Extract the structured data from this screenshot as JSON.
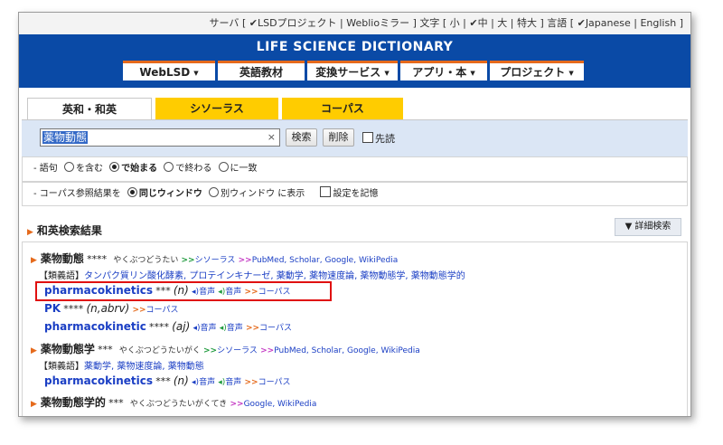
{
  "topbar": {
    "server_label": "サーバ",
    "server_opt1": "LSDプロジェクト",
    "server_opt2": "Weblioミラー",
    "text_label": "文字",
    "text_small": "小",
    "text_medium": "中",
    "text_large": "大",
    "text_xlarge": "特大",
    "lang_label": "言語",
    "lang_japanese": "Japanese",
    "lang_english": "English"
  },
  "header": {
    "title": "LIFE SCIENCE DICTIONARY",
    "nav": [
      {
        "label": "WebLSD",
        "has_menu": true
      },
      {
        "label": "英語教材",
        "has_menu": false
      },
      {
        "label": "変換サービス",
        "has_menu": true
      },
      {
        "label": "アプリ・本",
        "has_menu": true
      },
      {
        "label": "プロジェクト",
        "has_menu": true
      }
    ]
  },
  "tabs": [
    {
      "label": "英和・和英",
      "active": true
    },
    {
      "label": "シソーラス",
      "active": false
    },
    {
      "label": "コーパス",
      "active": false
    }
  ],
  "search": {
    "value": "薬物動態",
    "clear_icon": "×",
    "search_button": "検索",
    "delete_button": "削除",
    "prefix_label": "先読"
  },
  "options": {
    "phrase": {
      "label": "語句",
      "choices": [
        "を含む",
        "で始まる",
        "で終わる",
        "に一致"
      ],
      "selected": "で始まる"
    },
    "corpus": {
      "label": "コーパス参照結果を",
      "choices": [
        "同じウィンドウ",
        "別ウィンドウ"
      ],
      "selected": "同じウィンドウ",
      "suffix": "に表示",
      "remember_label": "設定を記憶"
    }
  },
  "results": {
    "heading": "和英検索結果",
    "advanced_button": "▼ 詳細検索",
    "entries": [
      {
        "headword": "薬物動態",
        "stars": "****",
        "reading": "やくぶつどうたい",
        "thesaurus": "シソーラス",
        "links": [
          "PubMed",
          "Scholar",
          "Google",
          "WikiPedia"
        ],
        "related_label": "【類義語】",
        "related": "タンパク質リン酸化酵素, プロテインキナーゼ, 薬動学, 薬物速度論, 薬物動態学, 薬物動態学的"
      },
      {
        "english": "pharmacokinetics",
        "stars": "***",
        "pos": "(n)",
        "audio1": "音声",
        "audio2": "音声",
        "corpus": "コーパス",
        "highlighted": true
      },
      {
        "english": "PK",
        "stars": "****",
        "pos": "(n,abrv)",
        "corpus": "コーパス"
      },
      {
        "english": "pharmacokinetic",
        "stars": "****",
        "pos": "(aj)",
        "audio1": "音声",
        "audio2": "音声",
        "corpus": "コーパス"
      },
      {
        "headword": "薬物動態学",
        "stars": "***",
        "reading": "やくぶつどうたいがく",
        "thesaurus": "シソーラス",
        "links": [
          "PubMed",
          "Scholar",
          "Google",
          "WikiPedia"
        ],
        "related_label": "【類義語】",
        "related": "薬動学, 薬物速度論, 薬物動態"
      },
      {
        "english": "pharmacokinetics",
        "stars": "***",
        "pos": "(n)",
        "audio1": "音声",
        "audio2": "音声",
        "corpus": "コーパス"
      },
      {
        "headword": "薬物動態学的",
        "stars": "***",
        "reading": "やくぶつどうたいがくてき",
        "links": [
          "Google",
          "WikiPedia"
        ]
      }
    ]
  }
}
